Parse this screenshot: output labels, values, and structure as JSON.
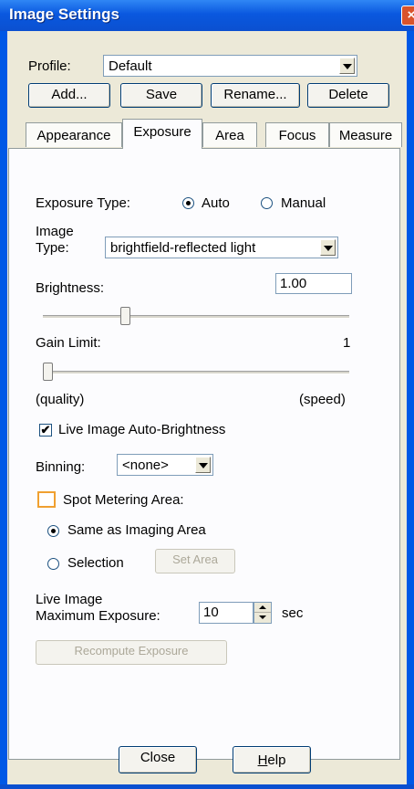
{
  "window": {
    "title": "Image Settings",
    "close_glyph": "×"
  },
  "profile": {
    "label": "Profile:",
    "value": "Default",
    "buttons": {
      "add": "Add...",
      "save": "Save",
      "rename": "Rename...",
      "delete": "Delete"
    }
  },
  "tabs": [
    {
      "label": "Appearance",
      "active": false
    },
    {
      "label": "Exposure",
      "active": true
    },
    {
      "label": "Area",
      "active": false
    },
    {
      "label": "Focus",
      "active": false
    },
    {
      "label": "Measure",
      "active": false
    }
  ],
  "exposure": {
    "type_label": "Exposure Type:",
    "auto_label": "Auto",
    "manual_label": "Manual",
    "selected_type": "Auto",
    "image_type_label_1": "Image",
    "image_type_label_2": "Type:",
    "image_type_value": "brightfield-reflected light",
    "brightness_label": "Brightness:",
    "brightness_value": "1.00",
    "brightness_level": 0.26,
    "gain_label": "Gain Limit:",
    "gain_value": "1",
    "gain_level": 0.0,
    "quality_label": "(quality)",
    "speed_label": "(speed)",
    "live_auto_brightness_label": "Live Image Auto-Brightness",
    "live_auto_brightness_checked": true,
    "binning_label": "Binning:",
    "binning_value": "<none>",
    "spot_metering_label": "Spot Metering Area:",
    "same_as_imaging_label": "Same as Imaging Area",
    "selection_label": "Selection",
    "set_area_button": "Set Area",
    "live_max_label_1": "Live Image",
    "live_max_label_2": "Maximum Exposure:",
    "live_max_value": "10",
    "live_max_unit": "sec",
    "recompute_button": "Recompute Exposure"
  },
  "footer": {
    "close_button": "Close",
    "help_button_first": "H",
    "help_button_rest": "elp"
  },
  "colors": {
    "titlebar": "#0a58df",
    "client": "#ece9d8",
    "accent_orange": "#f0a030"
  }
}
